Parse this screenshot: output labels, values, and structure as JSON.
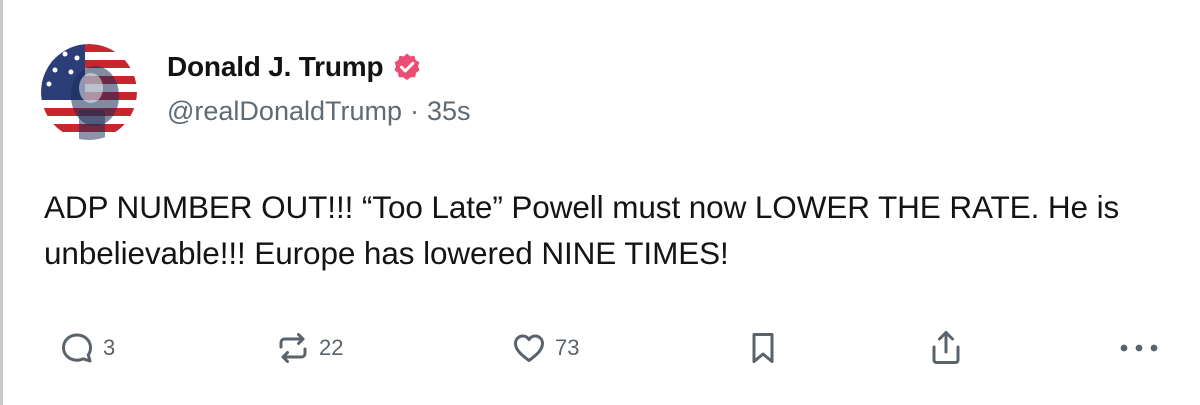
{
  "post": {
    "author": {
      "display_name": "Donald J. Trump",
      "verified": true,
      "handle": "@realDonaldTrump",
      "separator": "·",
      "time_ago": "35s",
      "avatar_icon": "flag-portrait-avatar"
    },
    "body": "ADP NUMBER OUT!!! “Too Late” Powell must now LOWER THE RATE. He is unbelievable!!! Europe has lowered NINE TIMES!"
  },
  "actions": {
    "reply": {
      "icon": "reply-icon",
      "count": "3"
    },
    "repost": {
      "icon": "repost-icon",
      "count": "22"
    },
    "like": {
      "icon": "heart-icon",
      "count": "73"
    },
    "bookmark": {
      "icon": "bookmark-icon"
    },
    "share": {
      "icon": "share-icon"
    },
    "more": {
      "icon": "more-icon"
    }
  },
  "colors": {
    "verified_badge": "#e94f73",
    "icon_gray": "#5a636b",
    "handle_gray": "#5f6b73",
    "text": "#141414"
  }
}
